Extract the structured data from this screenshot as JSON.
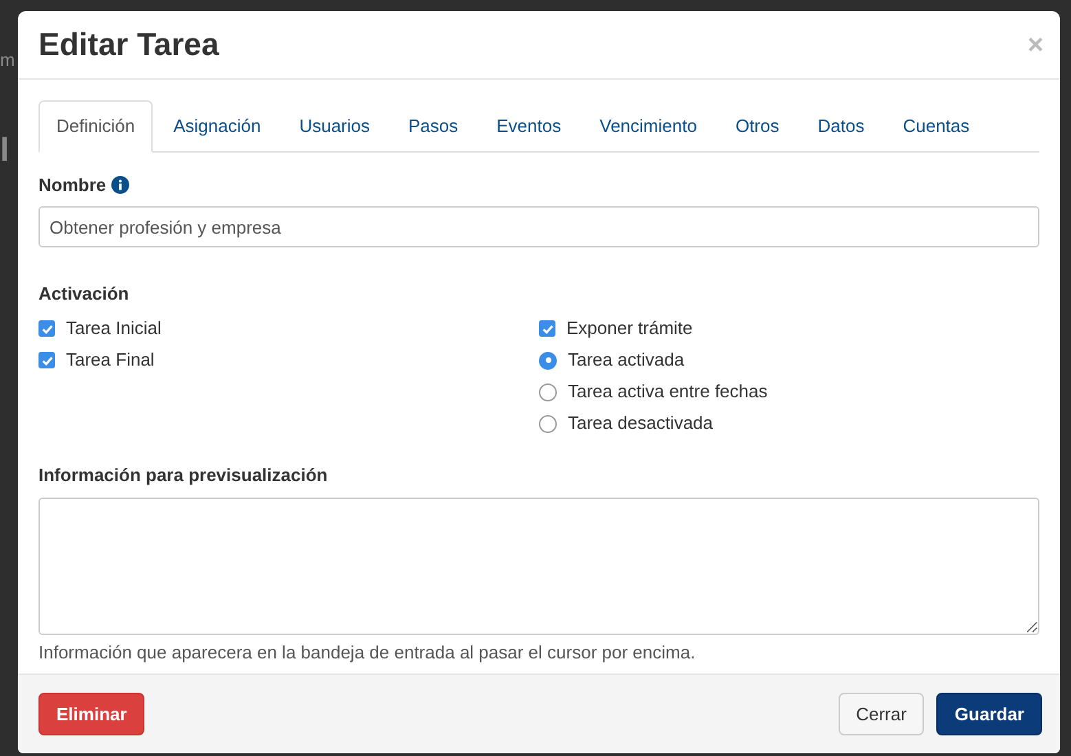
{
  "background": {
    "fragments": [
      "m",
      "l"
    ]
  },
  "dialog": {
    "title": "Editar Tarea",
    "close": "×",
    "tabs": [
      {
        "label": "Definición",
        "selected": true
      },
      {
        "label": "Asignación",
        "selected": false
      },
      {
        "label": "Usuarios",
        "selected": false
      },
      {
        "label": "Pasos",
        "selected": false
      },
      {
        "label": "Eventos",
        "selected": false
      },
      {
        "label": "Vencimiento",
        "selected": false
      },
      {
        "label": "Otros",
        "selected": false
      },
      {
        "label": "Datos",
        "selected": false
      },
      {
        "label": "Cuentas",
        "selected": false
      }
    ],
    "name_field": {
      "label": "Nombre",
      "value": "Obtener profesión y empresa"
    },
    "activation": {
      "label": "Activación",
      "left_options": [
        {
          "kind": "checkbox",
          "label": "Tarea Inicial",
          "checked": true
        },
        {
          "kind": "checkbox",
          "label": "Tarea Final",
          "checked": true
        }
      ],
      "right_options": [
        {
          "kind": "checkbox",
          "label": "Exponer trámite",
          "checked": true
        },
        {
          "kind": "radio",
          "label": "Tarea activada",
          "checked": true
        },
        {
          "kind": "radio",
          "label": "Tarea activa entre fechas",
          "checked": false
        },
        {
          "kind": "radio",
          "label": "Tarea desactivada",
          "checked": false
        }
      ]
    },
    "preview": {
      "label": "Información para previsualización",
      "help": "Información que aparecera en la bandeja de entrada al pasar el cursor por encima."
    },
    "buttons": [
      {
        "kind": "danger",
        "label": "Eliminar"
      },
      {
        "kind": "default",
        "label": "Cerrar"
      },
      {
        "kind": "primary",
        "label": "Guardar"
      }
    ]
  }
}
